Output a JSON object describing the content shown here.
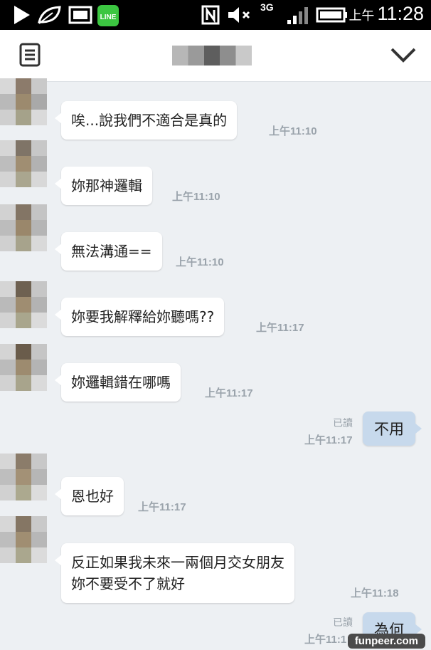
{
  "status_bar": {
    "time_prefix": "上午",
    "time": "11:28",
    "network_label": "3G",
    "icons": [
      "play-icon",
      "leaf-icon",
      "image-icon",
      "line-icon",
      "nfc-icon",
      "mute-icon",
      "signal-icon",
      "battery-icon"
    ]
  },
  "header": {
    "menu_icon": "notes-icon",
    "chevron_icon": "chevron-down-icon"
  },
  "messages": [
    {
      "dir": "in",
      "text": "唉...說我們不適合是真的",
      "time": "上午11:10"
    },
    {
      "dir": "in",
      "text": "妳那神邏輯",
      "time": "上午11:10"
    },
    {
      "dir": "in",
      "text": "無法溝通==",
      "time": "上午11:10"
    },
    {
      "dir": "in",
      "text": "妳要我解釋給妳聽嗎??",
      "time": "上午11:17"
    },
    {
      "dir": "in",
      "text": "妳邏輯錯在哪嗎",
      "time": "上午11:17"
    },
    {
      "dir": "out",
      "text": "不用",
      "time": "上午11:17",
      "read": "已讀"
    },
    {
      "dir": "in",
      "text": "恩也好",
      "time": "上午11:17"
    },
    {
      "dir": "in",
      "text": "反正如果我未來一兩個月交女朋友\n妳不要受不了就好",
      "time": "上午11:18"
    },
    {
      "dir": "out",
      "text": "為何",
      "time": "上午11:1",
      "read": "已讀"
    }
  ],
  "watermark": "funpeer.com"
}
